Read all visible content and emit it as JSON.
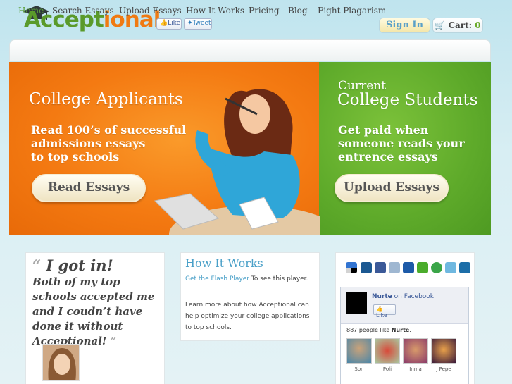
{
  "brand": {
    "name_a": "Accept",
    "name_b": "ional"
  },
  "social": {
    "like": "Like",
    "tweet": "Tweet"
  },
  "header": {
    "signin": "Sign In",
    "cart_label": "Cart:",
    "cart_count": "0"
  },
  "nav": [
    "Home",
    "Search Essays",
    "Upload Essays",
    "How It Works",
    "Pricing",
    "Blog",
    "Fight Plagarism"
  ],
  "hero": {
    "left": {
      "title": "College Applicants",
      "lines": [
        "Read 100’s of successful",
        "admissions essays",
        "to top schools"
      ],
      "button": "Read Essays"
    },
    "right": {
      "title_small": "Current",
      "title": "College Students",
      "lines": [
        "Get paid when",
        "someone reads your",
        "entrence essays"
      ],
      "button": "Upload Essays"
    }
  },
  "testimonial": {
    "open_quote": "“",
    "headline": "I got in!",
    "body": "Both of my top schools accepted me and I coudn’t have done it without Acceptional!",
    "close_quote": "”"
  },
  "how_it_works": {
    "title": "How It Works",
    "flash_link": "Get the Flash Player",
    "flash_rest": " To see this player.",
    "body": "Learn more about how Acceptional can help optimize your college applications to top schools."
  },
  "share_icons": [
    "delicious-icon",
    "digg-icon",
    "facebook-icon",
    "google-icon",
    "myspace-icon",
    "stumbleupon-icon",
    "technorati-icon",
    "twitter-icon",
    "linkedin-icon"
  ],
  "facebook_box": {
    "name": "Nurte",
    "on": " on Facebook",
    "like": "Like",
    "count_prefix": "887 people like ",
    "count_name": "Nurte",
    "count_suffix": ".",
    "fans": [
      "Son",
      "Poli",
      "Inma",
      "J Pepe"
    ]
  },
  "colors": {
    "orange": "#f47a12",
    "green": "#5eaa2a",
    "link_blue": "#4aa0c8",
    "nav_active": "#5aa03a"
  }
}
